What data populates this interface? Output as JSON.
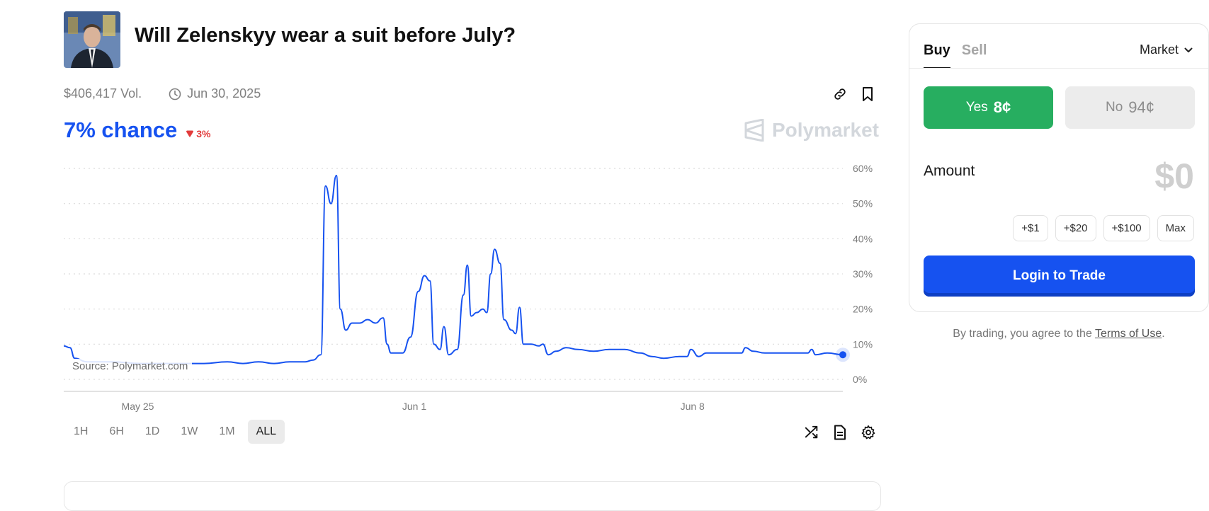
{
  "market": {
    "title": "Will Zelenskyy wear a suit before July?",
    "volume": "$406,417 Vol.",
    "end_date": "Jun 30, 2025",
    "chance": "7% chance",
    "change": "3%",
    "change_direction": "down",
    "brand": "Polymarket",
    "source_label": "Source: Polymarket.com"
  },
  "header_actions": {
    "link_icon": "link-icon",
    "bookmark_icon": "bookmark-icon"
  },
  "chart_data": {
    "type": "line",
    "series": [
      {
        "values": [
          {
            "t": 0.0,
            "y": 9.5
          },
          {
            "t": 0.008,
            "y": 9
          },
          {
            "t": 0.014,
            "y": 6
          },
          {
            "t": 0.03,
            "y": 5
          },
          {
            "t": 0.06,
            "y": 5
          },
          {
            "t": 0.1,
            "y": 4.5
          },
          {
            "t": 0.14,
            "y": 4.5
          },
          {
            "t": 0.18,
            "y": 4.5
          },
          {
            "t": 0.21,
            "y": 5
          },
          {
            "t": 0.23,
            "y": 4.5
          },
          {
            "t": 0.25,
            "y": 5
          },
          {
            "t": 0.27,
            "y": 4.5
          },
          {
            "t": 0.29,
            "y": 5
          },
          {
            "t": 0.31,
            "y": 5
          },
          {
            "t": 0.32,
            "y": 5.5
          },
          {
            "t": 0.33,
            "y": 7
          },
          {
            "t": 0.336,
            "y": 55
          },
          {
            "t": 0.343,
            "y": 50
          },
          {
            "t": 0.35,
            "y": 58
          },
          {
            "t": 0.355,
            "y": 20
          },
          {
            "t": 0.362,
            "y": 14
          },
          {
            "t": 0.37,
            "y": 16
          },
          {
            "t": 0.38,
            "y": 16
          },
          {
            "t": 0.39,
            "y": 17
          },
          {
            "t": 0.4,
            "y": 16
          },
          {
            "t": 0.41,
            "y": 17.5
          },
          {
            "t": 0.415,
            "y": 10
          },
          {
            "t": 0.42,
            "y": 7.5
          },
          {
            "t": 0.435,
            "y": 7.5
          },
          {
            "t": 0.445,
            "y": 12
          },
          {
            "t": 0.455,
            "y": 25
          },
          {
            "t": 0.463,
            "y": 29.5
          },
          {
            "t": 0.47,
            "y": 28
          },
          {
            "t": 0.475,
            "y": 10
          },
          {
            "t": 0.483,
            "y": 8.5
          },
          {
            "t": 0.488,
            "y": 15
          },
          {
            "t": 0.494,
            "y": 7
          },
          {
            "t": 0.505,
            "y": 8.5
          },
          {
            "t": 0.513,
            "y": 24
          },
          {
            "t": 0.518,
            "y": 32.5
          },
          {
            "t": 0.523,
            "y": 18
          },
          {
            "t": 0.53,
            "y": 19
          },
          {
            "t": 0.538,
            "y": 20
          },
          {
            "t": 0.543,
            "y": 19
          },
          {
            "t": 0.548,
            "y": 30
          },
          {
            "t": 0.553,
            "y": 37
          },
          {
            "t": 0.56,
            "y": 33
          },
          {
            "t": 0.565,
            "y": 17
          },
          {
            "t": 0.575,
            "y": 14
          },
          {
            "t": 0.58,
            "y": 13
          },
          {
            "t": 0.585,
            "y": 20.5
          },
          {
            "t": 0.59,
            "y": 10
          },
          {
            "t": 0.6,
            "y": 10
          },
          {
            "t": 0.61,
            "y": 9.5
          },
          {
            "t": 0.615,
            "y": 10
          },
          {
            "t": 0.622,
            "y": 7
          },
          {
            "t": 0.632,
            "y": 8
          },
          {
            "t": 0.645,
            "y": 9
          },
          {
            "t": 0.66,
            "y": 8.5
          },
          {
            "t": 0.68,
            "y": 8
          },
          {
            "t": 0.7,
            "y": 8.5
          },
          {
            "t": 0.72,
            "y": 8.5
          },
          {
            "t": 0.74,
            "y": 7.5
          },
          {
            "t": 0.755,
            "y": 6.5
          },
          {
            "t": 0.77,
            "y": 6
          },
          {
            "t": 0.79,
            "y": 6.5
          },
          {
            "t": 0.8,
            "y": 6.5
          },
          {
            "t": 0.805,
            "y": 8.5
          },
          {
            "t": 0.815,
            "y": 6.5
          },
          {
            "t": 0.825,
            "y": 7.5
          },
          {
            "t": 0.85,
            "y": 7.5
          },
          {
            "t": 0.87,
            "y": 7.5
          },
          {
            "t": 0.875,
            "y": 9
          },
          {
            "t": 0.885,
            "y": 8
          },
          {
            "t": 0.9,
            "y": 7.5
          },
          {
            "t": 0.93,
            "y": 7.5
          },
          {
            "t": 0.955,
            "y": 7.5
          },
          {
            "t": 0.96,
            "y": 8.5
          },
          {
            "t": 0.965,
            "y": 7
          },
          {
            "t": 0.98,
            "y": 7.5
          },
          {
            "t": 1.0,
            "y": 7
          }
        ]
      }
    ],
    "ylim": [
      0,
      60
    ],
    "y_ticks": [
      "60%",
      "50%",
      "40%",
      "30%",
      "20%",
      "10%",
      "0%"
    ],
    "y_tick_values": [
      60,
      50,
      40,
      30,
      20,
      10,
      0
    ],
    "x_ticks": [
      "May 25",
      "Jun 1",
      "Jun 8"
    ],
    "x_tick_values": [
      0.095,
      0.45,
      0.807
    ],
    "grid": true,
    "line_color": "#1652f0",
    "last_value": 7
  },
  "ranges": [
    "1H",
    "6H",
    "1D",
    "1W",
    "1M",
    "ALL"
  ],
  "active_range": "ALL",
  "chart_tools": {
    "shuffle": "shuffle-icon",
    "document": "document-icon",
    "settings": "gear-icon"
  },
  "trade": {
    "tab_buy": "Buy",
    "tab_sell": "Sell",
    "order_type": "Market",
    "yes_label": "Yes",
    "yes_price": "8¢",
    "no_label": "No",
    "no_price": "94¢",
    "amount_label": "Amount",
    "amount_value": "$0",
    "quick_amounts": [
      "+$1",
      "+$20",
      "+$100",
      "Max"
    ],
    "login_label": "Login to Trade",
    "terms_prefix": "By trading, you agree to the ",
    "terms_link": "Terms of Use",
    "terms_suffix": "."
  },
  "colors": {
    "accent": "#1652f0",
    "yes": "#27ae60",
    "no_bg": "#ececec",
    "down": "#e23b3b"
  }
}
